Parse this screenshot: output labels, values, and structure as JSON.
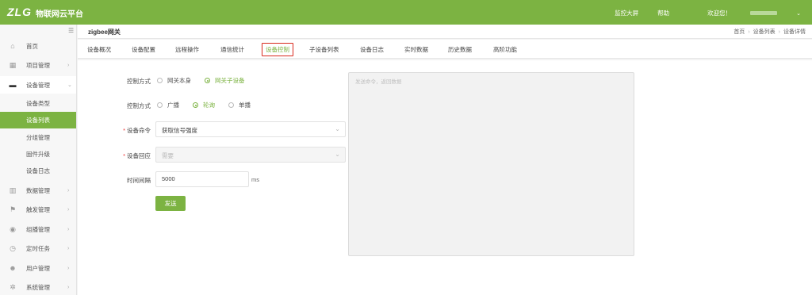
{
  "topbar": {
    "logo": "ZLG",
    "brand": "物联网云平台",
    "links": [
      "监控大屏",
      "帮助"
    ],
    "welcome": "欢迎您！",
    "accent": "#7cb342"
  },
  "sidebar": {
    "items": [
      {
        "label": "首页",
        "icon": "home-icon"
      },
      {
        "label": "项目管理",
        "icon": "project-icon"
      },
      {
        "label": "设备管理",
        "icon": "device-icon"
      },
      {
        "label": "数据管理",
        "icon": "data-icon"
      },
      {
        "label": "触发管理",
        "icon": "flag-icon"
      },
      {
        "label": "组播管理",
        "icon": "multicast-icon"
      },
      {
        "label": "定时任务",
        "icon": "timer-icon"
      },
      {
        "label": "用户管理",
        "icon": "user-icon"
      },
      {
        "label": "系统管理",
        "icon": "settings-icon"
      }
    ],
    "sub_items": [
      "设备类型",
      "设备列表",
      "分组管理",
      "固件升级",
      "设备日志"
    ]
  },
  "header": {
    "title": "zigbee网关",
    "breadcrumb": [
      "首页",
      "设备列表",
      "设备详情"
    ]
  },
  "tabs": [
    "设备概况",
    "设备配置",
    "远程操作",
    "通信统计",
    "设备控制",
    "子设备列表",
    "设备日志",
    "实时数据",
    "历史数据",
    "高阶功能"
  ],
  "form": {
    "control_mode1": {
      "label": "控制方式",
      "options": [
        "网关本身",
        "网关子设备"
      ],
      "selected": "网关子设备"
    },
    "control_mode2": {
      "label": "控制方式",
      "options": [
        "广播",
        "轮询",
        "单播"
      ],
      "selected": "轮询"
    },
    "command": {
      "label": "设备命令",
      "value": "获取信号强度"
    },
    "response": {
      "label": "设备回应",
      "value": "需要"
    },
    "interval": {
      "label": "时间间隔",
      "value": "5000",
      "unit": "ms"
    },
    "send_label": "发送"
  },
  "result": {
    "placeholder": "发送命令，返回数据"
  }
}
